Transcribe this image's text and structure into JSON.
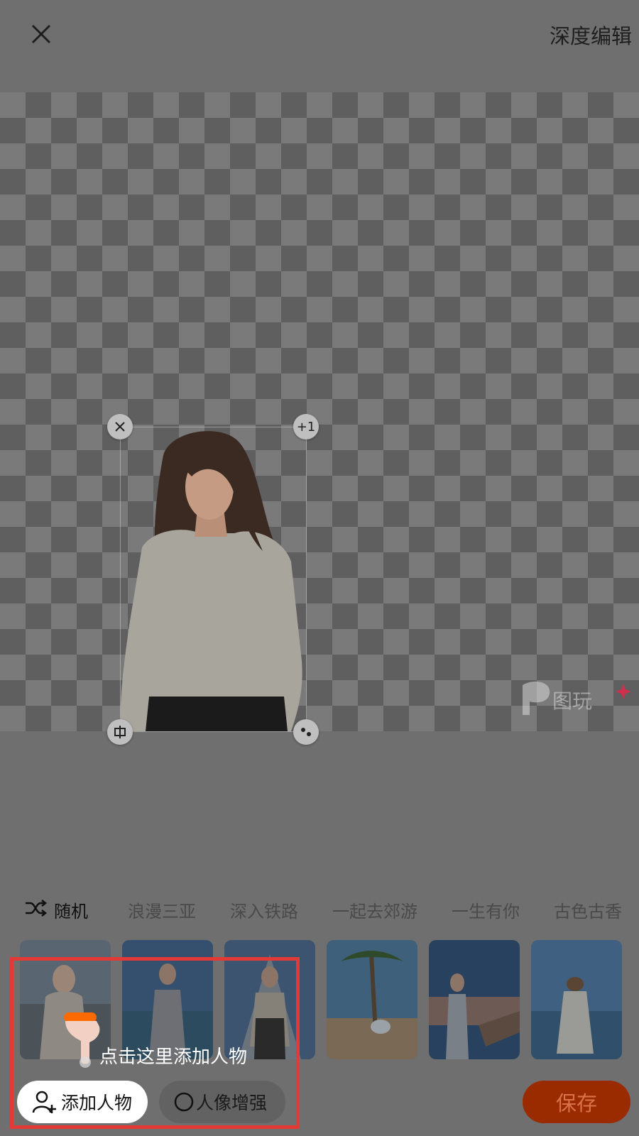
{
  "header": {
    "deep_edit_label": "深度编辑"
  },
  "canvas": {
    "plus_one_label": "+1"
  },
  "watermark": {
    "text": "图玩"
  },
  "tabs": [
    {
      "label": "随机"
    },
    {
      "label": "浪漫三亚"
    },
    {
      "label": "深入铁路"
    },
    {
      "label": "一起去郊游"
    },
    {
      "label": "一生有你"
    },
    {
      "label": "古色古香"
    }
  ],
  "hint": {
    "text": "点击这里添加人物"
  },
  "buttons": {
    "add_person": "添加人物",
    "enhance": "人像增强",
    "save": "保存"
  },
  "colors": {
    "highlight": "#e53935",
    "save_bg": "#9a2a00",
    "hand_accent": "#ff6a00"
  }
}
